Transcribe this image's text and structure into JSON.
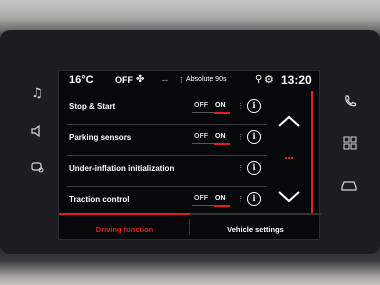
{
  "status_bar": {
    "temperature": "16°C",
    "ac_state": "OFF",
    "fan_icon": "fan-icon",
    "dash": "--",
    "separator": "⁝",
    "radio_station": "Absolute 90s",
    "clock": "13:20"
  },
  "settings": [
    {
      "label": "Stop & Start",
      "has_toggle": true,
      "off_label": "OFF",
      "on_label": "ON",
      "state": "ON"
    },
    {
      "label": "Parking sensors",
      "has_toggle": true,
      "off_label": "OFF",
      "on_label": "ON",
      "state": "ON"
    },
    {
      "label": "Under-inflation initialization",
      "has_toggle": false
    },
    {
      "label": "Traction control",
      "has_toggle": true,
      "off_label": "OFF",
      "on_label": "ON",
      "state": "ON"
    }
  ],
  "info_glyph": "i",
  "tabs": [
    {
      "label": "Driving function",
      "active": true
    },
    {
      "label": "Vehicle settings",
      "active": false
    }
  ],
  "colors": {
    "accent": "#e01e25",
    "background": "#07080a",
    "text": "#ffffff"
  },
  "side_keys": {
    "left": [
      "music-note-icon",
      "volume-icon",
      "car-settings-icon"
    ],
    "right": [
      "phone-icon",
      "apps-grid-icon",
      "vehicle-icon"
    ]
  }
}
